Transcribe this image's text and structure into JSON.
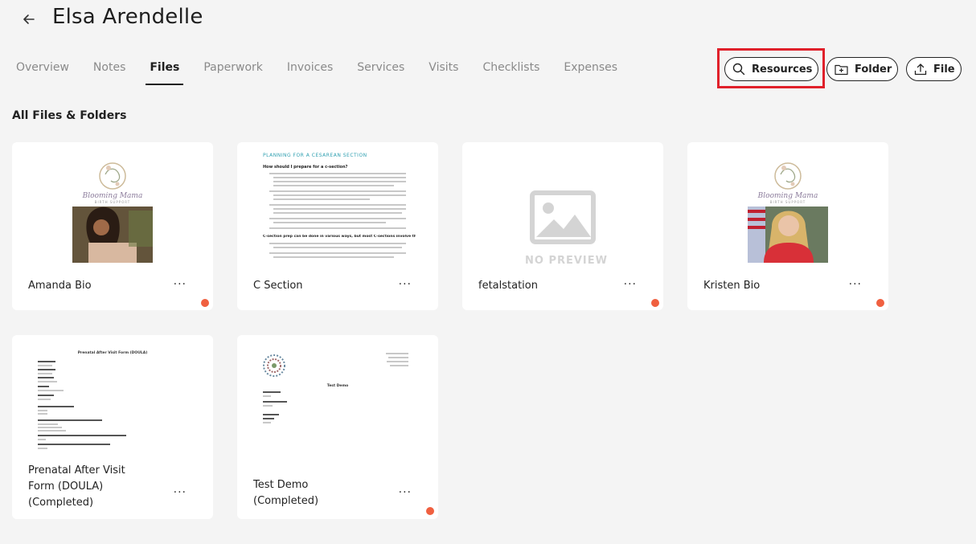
{
  "header": {
    "title": "Elsa Arendelle"
  },
  "tabs": [
    {
      "label": "Overview"
    },
    {
      "label": "Notes"
    },
    {
      "label": "Files",
      "active": true
    },
    {
      "label": "Paperwork"
    },
    {
      "label": "Invoices"
    },
    {
      "label": "Services"
    },
    {
      "label": "Visits"
    },
    {
      "label": "Checklists"
    },
    {
      "label": "Expenses"
    }
  ],
  "actions": {
    "resources": "Resources",
    "folder": "Folder",
    "file": "File"
  },
  "section_title": "All Files & Folders",
  "files": [
    {
      "name": "Amanda Bio",
      "logo_text": "Blooming Mama",
      "logo_sub": "BIRTH SUPPORT"
    },
    {
      "name": "C Section",
      "doc_title": "PLANNING FOR A CESAREAN SECTION",
      "doc_heading": "How should I prepare for a c-section?",
      "doc_heading2": "C-section prep can be done in various ways, but most C-sections involve these steps:"
    },
    {
      "name": "fetalstation",
      "preview_text": "NO PREVIEW"
    },
    {
      "name": "Kristen Bio",
      "logo_text": "Blooming Mama",
      "logo_sub": "BIRTH SUPPORT"
    },
    {
      "name": "Prenatal After Visit Form (DOULA) (Completed)",
      "name_lines": [
        "Prenatal After Visit",
        "Form (DOULA)",
        "(Completed)"
      ],
      "doc_title": "Prenatal After Visit Form (DOULA)"
    },
    {
      "name": "Test Demo (Completed)",
      "name_lines": [
        "Test Demo",
        "(Completed)"
      ],
      "doc_title": "Test Demo"
    }
  ],
  "colors": {
    "accent_dot": "#f06040",
    "highlight": "#e0202a",
    "background": "#f4f4f4"
  }
}
